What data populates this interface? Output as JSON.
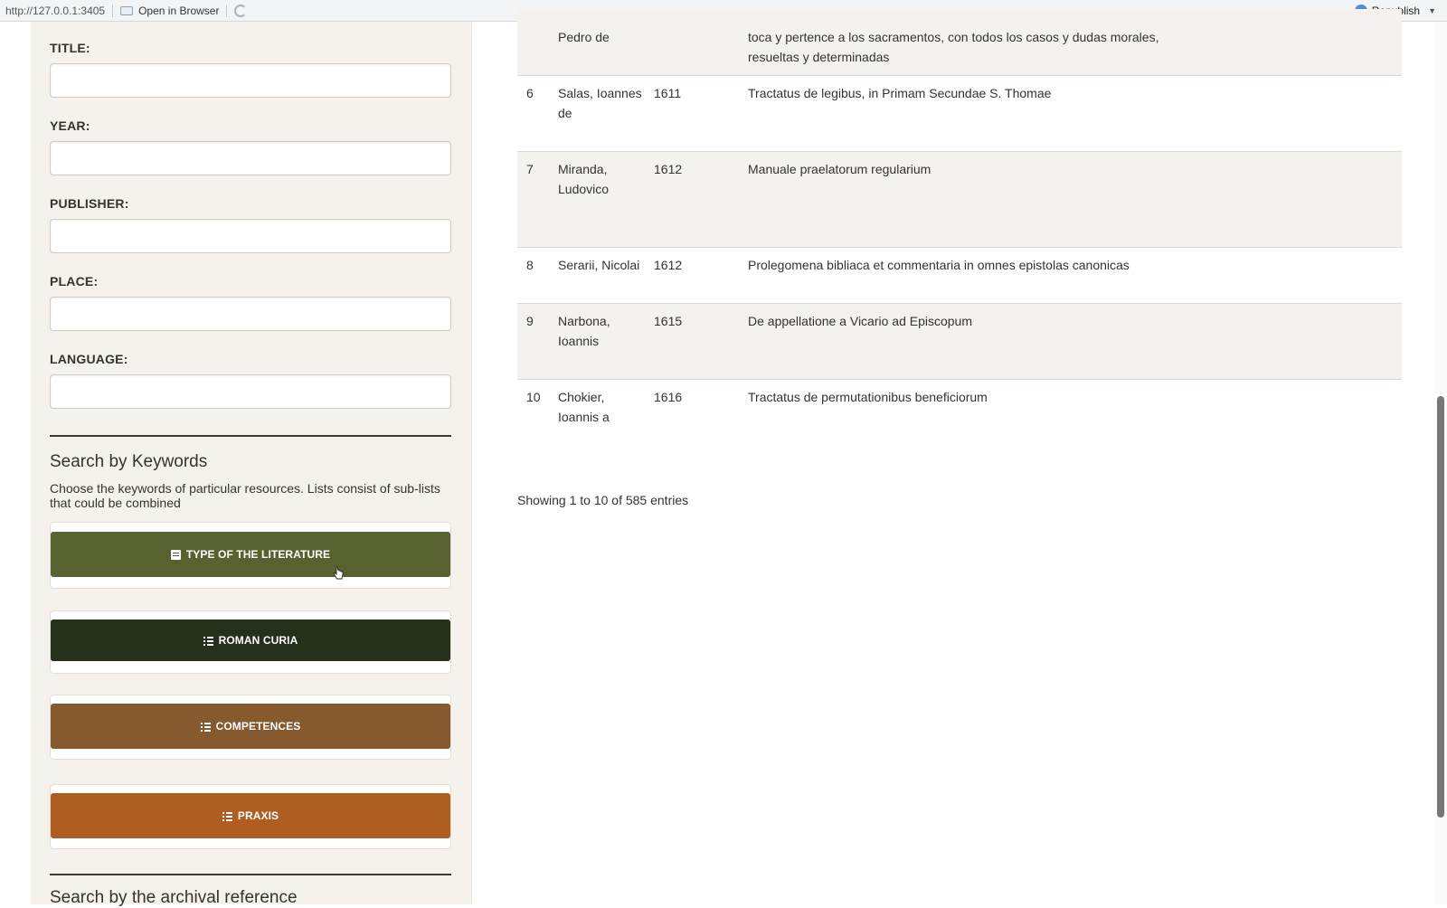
{
  "browser": {
    "url": "http://127.0.0.1:3405",
    "open_in_browser": "Open in Browser",
    "republish": "Republish"
  },
  "sidebar": {
    "fields": [
      {
        "label": "TITLE:",
        "value": ""
      },
      {
        "label": "YEAR:",
        "value": ""
      },
      {
        "label": "PUBLISHER:",
        "value": ""
      },
      {
        "label": "PLACE:",
        "value": ""
      },
      {
        "label": "LANGUAGE:",
        "value": ""
      }
    ],
    "keywords_title": "Search by Keywords",
    "keywords_desc": "Choose the keywords of particular resources. Lists consist of sub-lists that could be combined",
    "buttons": [
      {
        "label": "TYPE OF THE LITERATURE",
        "icon": "book-icon",
        "color": "#566330"
      },
      {
        "label": "ROMAN CURIA",
        "icon": "list-icon",
        "color": "#24301a"
      },
      {
        "label": "COMPETENCES",
        "icon": "list-icon",
        "color": "#87592f"
      },
      {
        "label": "PRAXIS",
        "icon": "list-icon",
        "color": "#b05d22"
      }
    ],
    "archival_title": "Search by the archival reference"
  },
  "table": {
    "rows": [
      {
        "num": "",
        "author": "Pedro de",
        "year": "",
        "title": "toca y pertence a los sacramentos, con todos los casos y dudas morales, resueltas y determinadas"
      },
      {
        "num": "6",
        "author": "Salas, Ioannes de",
        "year": "1611",
        "title": "Tractatus de legibus, in Primam Secundae S. Thomae"
      },
      {
        "num": "7",
        "author": "Miranda, Ludovico",
        "year": "1612",
        "title": "Manuale praelatorum regularium"
      },
      {
        "num": "8",
        "author": "Serarii, Nicolai",
        "year": "1612",
        "title": "Prolegomena bibliaca et commentaria in omnes epistolas canonicas"
      },
      {
        "num": "9",
        "author": "Narbona, Ioannis",
        "year": "1615",
        "title": "De appellatione a Vicario ad Episcopum"
      },
      {
        "num": "10",
        "author": "Chokier, Ioannis a",
        "year": "1616",
        "title": "Tractatus de permutationibus beneficiorum"
      }
    ],
    "info": "Showing 1 to 10 of 585 entries"
  }
}
